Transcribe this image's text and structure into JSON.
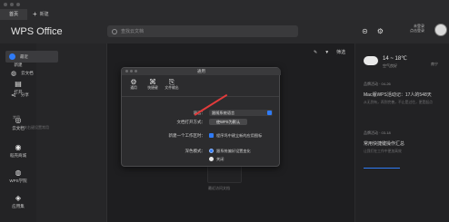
{
  "titlebar": {
    "home_tab": "首页",
    "new_tab": "新建"
  },
  "topbar": {
    "brand": "WPS Office",
    "search_placeholder": "查找云文档",
    "login_line1": "未登录",
    "login_line2": "点击登录"
  },
  "leftnav": [
    {
      "icon": "plus-icon",
      "label": "新建"
    },
    {
      "icon": "folder-icon",
      "label": "打开"
    },
    {
      "icon": "cloud-icon",
      "label": "云文档"
    },
    {
      "icon": "mail-icon",
      "label": "稻壳商城"
    },
    {
      "icon": "wps-icon",
      "label": "WPS学院"
    },
    {
      "icon": "app-icon",
      "label": "应用集"
    }
  ],
  "sidepanel": {
    "items": [
      {
        "label": "最近"
      },
      {
        "label": "云文档"
      },
      {
        "label": "分享"
      }
    ],
    "group": "常用",
    "sub": "在文件夹右键设置常用"
  },
  "main": {
    "tools_filter": "筛选",
    "empty_label": "最近访问文档"
  },
  "weather": {
    "temp": "14 ~ 18℃",
    "aq": "空气良好",
    "city": "南宁"
  },
  "news": [
    {
      "date": "品牌活动 · 04-26",
      "title": "Mac版WPS活动记：17人的548天",
      "body": "从无到有，再到完善，不止是过往，更是起点"
    },
    {
      "date": "品牌活动 · 03-18",
      "title": "常用快捷键操作汇总",
      "body": "让我们在工作中更加高效"
    }
  ],
  "dialog": {
    "title": "通用",
    "tabs": [
      {
        "icon": "gear-icon",
        "label": "通用"
      },
      {
        "icon": "command-icon",
        "label": "快捷键"
      },
      {
        "icon": "export-icon",
        "label": "文件输出"
      }
    ],
    "lang_label": "语言：",
    "lang_value": "跟随系统语言",
    "default_label": "文档打开方式：",
    "default_button": "使WPS为默认",
    "workspace_label": "新建一个工作区时：",
    "workspace_option": "程序坞中建立新的应用图标",
    "theme_label": "深色模式：",
    "theme_follow": "跟系统偏好设置变化",
    "theme_off": "关闭"
  }
}
